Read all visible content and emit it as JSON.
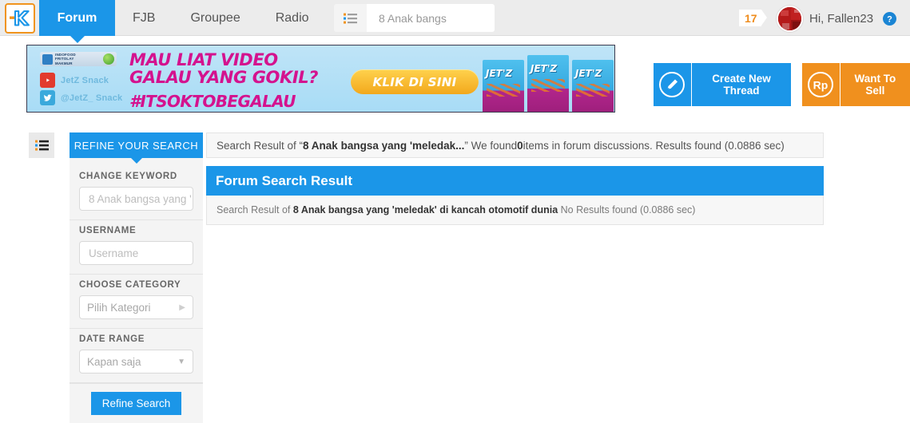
{
  "topnav": {
    "logo_alt": "Kaskus",
    "tabs": [
      {
        "label": "Forum",
        "active": true
      },
      {
        "label": "FJB",
        "active": false
      },
      {
        "label": "Groupee",
        "active": false
      },
      {
        "label": "Radio",
        "active": false
      }
    ],
    "list_icon": "list-icon",
    "search": {
      "value": "8 Anak bangs",
      "placeholder": "8 Anak bangs",
      "icon": "search-icon"
    },
    "notification_count": "17",
    "greeting": "Hi, Fallen23",
    "help_icon": "help-circle-icon"
  },
  "banner": {
    "brand_line1": "INDOFOOD",
    "brand_line2": "FRITOLAY",
    "brand_line3": "MAKMUR",
    "youtube_label": "JetZ Snack",
    "twitter_label": "@JetZ_ Snack",
    "headline_line1": "MAU LIAT VIDEO",
    "headline_line2": "GALAU YANG GOKIL?",
    "hashtag": "#ITSOKTOBEGALAU",
    "cta": "KLIK DI SINI",
    "product_name": "JET'Z"
  },
  "actions": {
    "create_thread": "Create New Thread",
    "create_thread_icon": "pencil-circle-icon",
    "want_to_sell": "Want To Sell",
    "want_to_sell_icon": "rupiah-circle-icon"
  },
  "sidebar": {
    "toggle_icon": "list-toggle-icon",
    "title": "REFINE YOUR SEARCH",
    "fields": [
      {
        "label": "CHANGE KEYWORD",
        "name": "change-keyword",
        "value": "8 Anak bangsa yang '",
        "placeholder": "8 Anak bangsa yang '",
        "kind": "text"
      },
      {
        "label": "USERNAME",
        "name": "username",
        "value": "",
        "placeholder": "Username",
        "kind": "text"
      },
      {
        "label": "CHOOSE CATEGORY",
        "name": "choose-category",
        "value": "Pilih Kategori",
        "placeholder": "Pilih Kategori",
        "kind": "flyout"
      },
      {
        "label": "DATE RANGE",
        "name": "date-range",
        "value": "Kapan saja",
        "placeholder": "Kapan saja",
        "kind": "select"
      }
    ],
    "submit_label": "Refine Search"
  },
  "main": {
    "result_bar": {
      "prefix": "Search Result of “",
      "query": "8 Anak bangsa yang 'meledak...",
      "mid": "” We found ",
      "count": "0",
      "suffix": " items in forum discussions. Results found (0.0886 sec)"
    },
    "panel_title": "Forum Search Result",
    "panel_body": {
      "prefix": "Search Result of ",
      "query": "8 Anak bangsa yang 'meledak' di kancah otomotif dunia",
      "suffix": " No Results found (0.0886 sec)"
    }
  },
  "colors": {
    "brand_blue": "#1b96e8",
    "brand_orange": "#f0901e",
    "banner_magenta": "#d4128e",
    "nav_bg": "#ececec"
  }
}
